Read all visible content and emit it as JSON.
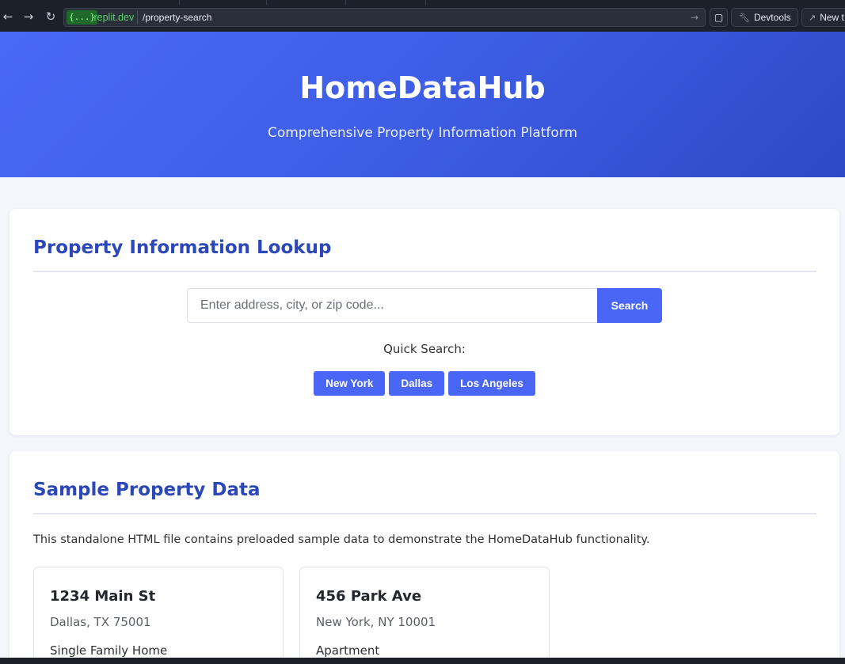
{
  "browser": {
    "url_tag": "{...}",
    "url_domain": ".replit.dev",
    "url_path": "/property-search",
    "devtools_label": "Devtools",
    "new_tab_label": "New t"
  },
  "header": {
    "title": "HomeDataHub",
    "subtitle": "Comprehensive Property Information Platform"
  },
  "lookup": {
    "heading": "Property Information Lookup",
    "search_placeholder": "Enter address, city, or zip code...",
    "search_button": "Search",
    "quick_label": "Quick Search:",
    "quick_buttons": [
      "New York",
      "Dallas",
      "Los Angeles"
    ]
  },
  "sample": {
    "heading": "Sample Property Data",
    "intro": "This standalone HTML file contains preloaded sample data to demonstrate the HomeDataHub functionality.",
    "properties": [
      {
        "address": "1234 Main St",
        "city": "Dallas, TX 75001",
        "type": "Single Family Home"
      },
      {
        "address": "456 Park Ave",
        "city": "New York, NY 10001",
        "type": "Apartment"
      }
    ]
  },
  "colors": {
    "accent": "#4a66f7",
    "heading": "#2c47b8",
    "hero_start": "#4a68f6",
    "hero_end": "#2d49c6"
  }
}
